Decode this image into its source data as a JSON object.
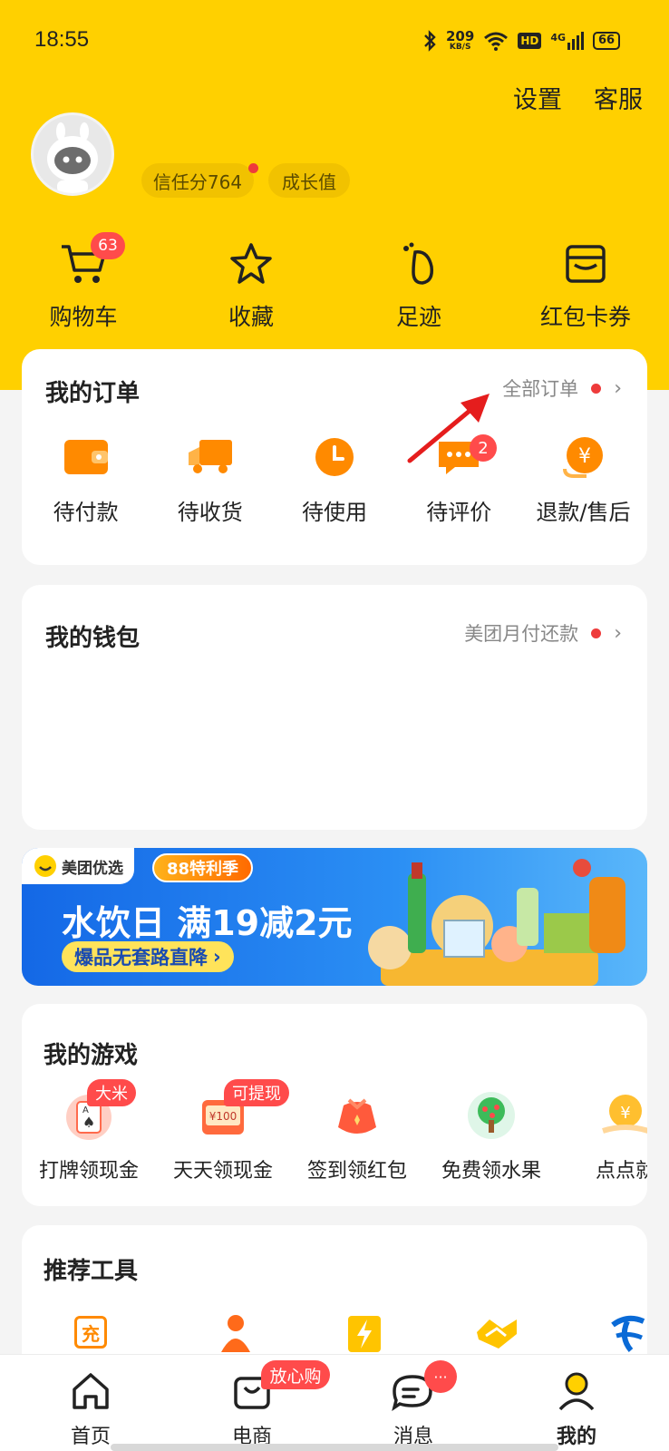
{
  "status_bar": {
    "time": "18:55",
    "net_speed": "209",
    "net_unit": "KB/S",
    "hd": "HD",
    "signal": "4G",
    "battery": "66"
  },
  "header": {
    "settings_label": "设置",
    "service_label": "客服"
  },
  "profile": {
    "trust_score_label": "信任分764",
    "growth_label": "成长值"
  },
  "quick_links": [
    {
      "label": "购物车",
      "icon": "cart-icon",
      "badge": "63"
    },
    {
      "label": "收藏",
      "icon": "star-icon"
    },
    {
      "label": "足迹",
      "icon": "footprint-icon"
    },
    {
      "label": "红包卡券",
      "icon": "wallet-card-icon"
    }
  ],
  "orders": {
    "title": "我的订单",
    "all_link": "全部订单",
    "items": [
      {
        "label": "待付款",
        "icon": "wallet-icon"
      },
      {
        "label": "待收货",
        "icon": "truck-icon"
      },
      {
        "label": "待使用",
        "icon": "clock-icon"
      },
      {
        "label": "待评价",
        "icon": "comment-icon",
        "badge": "2"
      },
      {
        "label": "退款/售后",
        "icon": "refund-icon"
      }
    ]
  },
  "wallet": {
    "title": "我的钱包",
    "link": "美团月付还款"
  },
  "banner": {
    "brand": "美团优选",
    "tag": "88特利季",
    "headline": "水饮日 满19减2元",
    "sub": "爆品无套路直降"
  },
  "games": {
    "title": "我的游戏",
    "items": [
      {
        "label": "打牌领现金",
        "icon": "card-game-icon",
        "badge": "大米"
      },
      {
        "label": "天天领现金",
        "icon": "cash-icon",
        "badge": "可提现",
        "amount": "¥100"
      },
      {
        "label": "签到领红包",
        "icon": "red-packet-icon"
      },
      {
        "label": "免费领水果",
        "icon": "fruit-tree-icon"
      },
      {
        "label": "点点就",
        "icon": "coin-hand-icon"
      }
    ]
  },
  "tools": {
    "title": "推荐工具",
    "recharge_glyph": "充"
  },
  "tabbar": {
    "items": [
      {
        "label": "首页",
        "icon": "home-icon"
      },
      {
        "label": "电商",
        "icon": "shop-bag-icon",
        "badge": "放心购"
      },
      {
        "label": "消息",
        "icon": "message-icon",
        "badge": "···"
      },
      {
        "label": "我的",
        "icon": "profile-icon"
      }
    ]
  },
  "colors": {
    "brand": "#ffd000",
    "accent_orange": "#ff8a00",
    "badge_red": "#ff4b4b",
    "banner_blue": "#1f7ef0"
  }
}
